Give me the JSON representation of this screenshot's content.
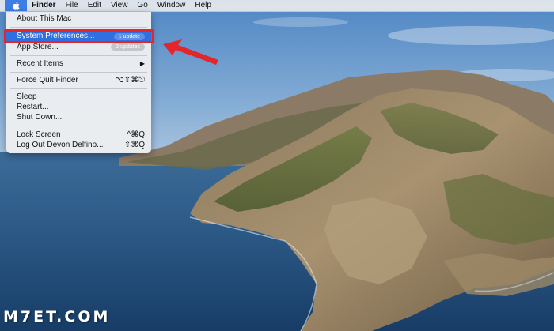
{
  "menubar": {
    "apple_icon": "apple-logo-icon",
    "items": [
      {
        "label": "Finder",
        "bold": true
      },
      {
        "label": "File"
      },
      {
        "label": "Edit"
      },
      {
        "label": "View"
      },
      {
        "label": "Go"
      },
      {
        "label": "Window"
      },
      {
        "label": "Help"
      }
    ]
  },
  "apple_menu": {
    "about": "About This Mac",
    "system_preferences": {
      "label": "System Preferences...",
      "badge": "1 update"
    },
    "app_store": {
      "label": "App Store...",
      "badge": "2 updates"
    },
    "recent_items": {
      "label": "Recent Items",
      "arrow": "▶"
    },
    "force_quit": {
      "label": "Force Quit Finder",
      "shortcut": "⌥⇧⌘⎋"
    },
    "sleep": "Sleep",
    "restart": "Restart...",
    "shut_down": "Shut Down...",
    "lock_screen": {
      "label": "Lock Screen",
      "shortcut": "^⌘Q"
    },
    "log_out": {
      "label": "Log Out Devon Delfino...",
      "shortcut": "⇧⌘Q"
    }
  },
  "annotation": {
    "color": "#e4262a"
  },
  "watermark": "M7ET.COM"
}
